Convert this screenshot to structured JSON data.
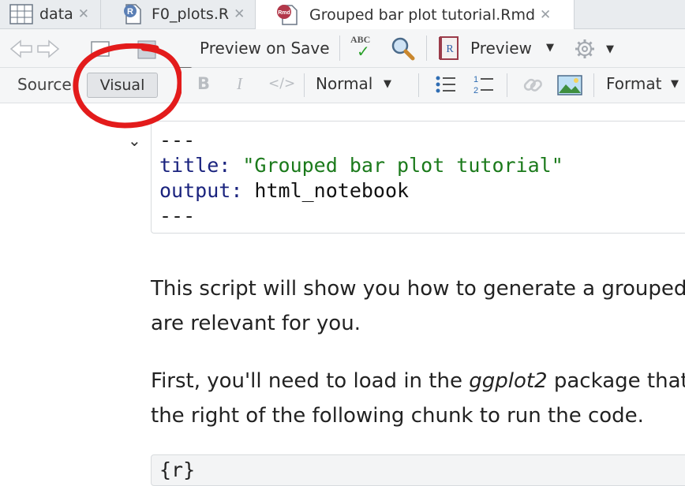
{
  "tabs": [
    {
      "label": "data",
      "icon": "table-icon"
    },
    {
      "label": "F0_plots.R",
      "icon": "r-script-icon"
    },
    {
      "label": "Grouped bar plot tutorial.Rmd",
      "icon": "rmd-file-icon",
      "active": true
    }
  ],
  "toolbar": {
    "preview_on_save_label": "Preview on Save",
    "preview_label": "Preview",
    "spell_label": "ABC"
  },
  "editor_toolbar": {
    "source_label": "Source",
    "visual_label": "Visual",
    "style_label": "Normal",
    "format_label": "Format",
    "bold_label": "B",
    "italic_label": "I"
  },
  "yaml": {
    "dashes": "---",
    "title_key": "title",
    "title_value": "\"Grouped bar plot tutorial\"",
    "output_key": "output",
    "output_value": "html_notebook"
  },
  "body": {
    "para1_line1": "This script will show you how to generate a grouped",
    "para1_line2": "are relevant for you.",
    "para2_pre": "First, you'll need to load in the ",
    "para2_em": "ggplot2",
    "para2_post": " package that",
    "para2_line2": "the right of the following chunk to run the code.",
    "code_line": "{r}"
  },
  "colors": {
    "annotation": "#e31b1b",
    "accent": "#2f6db3"
  }
}
